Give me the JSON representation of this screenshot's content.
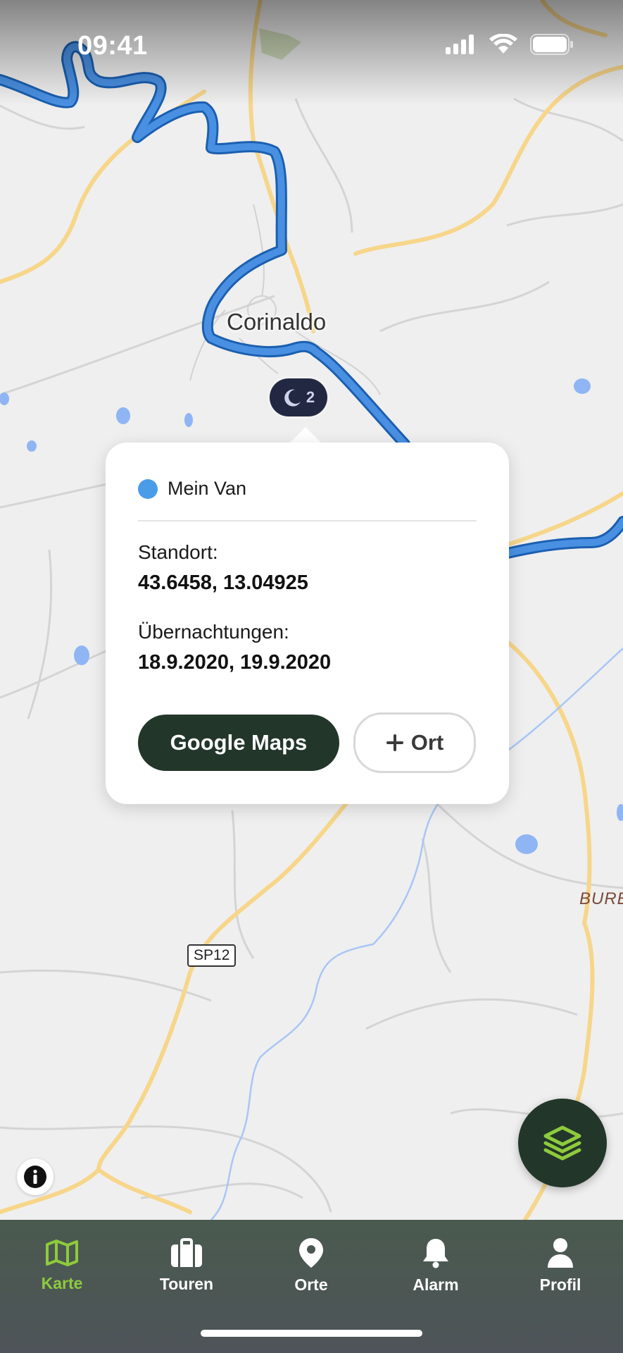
{
  "status_bar": {
    "time": "09:41"
  },
  "map": {
    "town_label": "Corinaldo",
    "road_shield": "SP12",
    "place_label": "BURE",
    "overnight_badge": {
      "count": "2",
      "icon": "moon-icon"
    },
    "colors": {
      "route": "#4a90e2",
      "road": "#f7d68a",
      "water": "#8fb5f5",
      "background": "#efefef"
    }
  },
  "popup": {
    "vehicle_name": "Mein Van",
    "vehicle_color": "#4a9be8",
    "location_label": "Standort:",
    "location_value": "43.6458, 13.04925",
    "nights_label": "Übernachtungen:",
    "nights_value": "18.9.2020, 19.9.2020",
    "google_maps_button": "Google Maps",
    "add_place_button": "Ort"
  },
  "fab": {
    "icon": "layers-icon"
  },
  "info": {
    "icon": "info-icon"
  },
  "tabbar": {
    "accent": "#8ecb3c",
    "items": [
      {
        "label": "Karte",
        "icon": "map-icon",
        "active": true
      },
      {
        "label": "Touren",
        "icon": "suitcase-icon",
        "active": false
      },
      {
        "label": "Orte",
        "icon": "location-pin-icon",
        "active": false
      },
      {
        "label": "Alarm",
        "icon": "bell-icon",
        "active": false
      },
      {
        "label": "Profil",
        "icon": "user-icon",
        "active": false
      }
    ]
  }
}
